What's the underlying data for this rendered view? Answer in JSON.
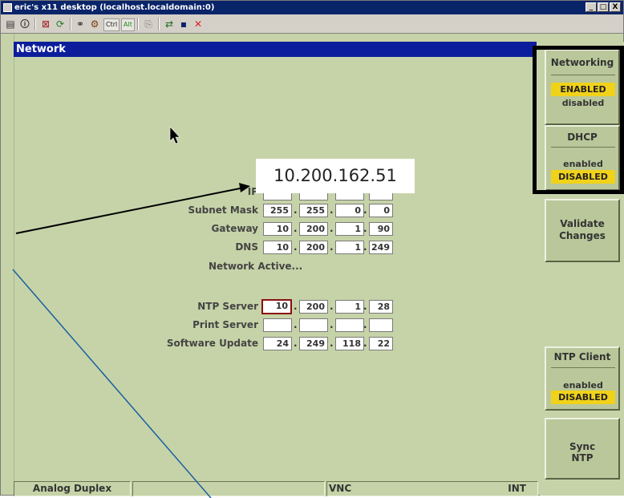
{
  "window": {
    "title": "eric's x11 desktop (localhost.localdomain:0)",
    "buttons": [
      "_",
      "□",
      "X"
    ]
  },
  "toolbar": {
    "icons": [
      "properties-icon",
      "info-icon",
      "fullscreen-icon",
      "refresh-icon",
      "pointer-icon",
      "keys-icon",
      "ctrl-key",
      "alt-key",
      "clipboard-icon",
      "transfer-icon",
      "save-icon",
      "disconnect-icon"
    ],
    "ctrl_label": "Ctrl",
    "alt_label": "Alt"
  },
  "header": {
    "title": "Network"
  },
  "callout": {
    "text": "10.200.162.51"
  },
  "form": {
    "ip_label_partial": "IP",
    "subnet": {
      "label": "Subnet Mask",
      "octets": [
        "255",
        "255",
        "0",
        "0"
      ]
    },
    "gateway": {
      "label": "Gateway",
      "octets": [
        "10",
        "200",
        "1",
        "90"
      ]
    },
    "dns": {
      "label": "DNS",
      "octets": [
        "10",
        "200",
        "1",
        "249"
      ]
    },
    "status": "Network Active...",
    "ntp": {
      "label": "NTP Server",
      "octets": [
        "10",
        "200",
        "1",
        "28"
      ]
    },
    "print": {
      "label": "Print Server",
      "octets": [
        "",
        "",
        "",
        ""
      ]
    },
    "update": {
      "label": "Software Update",
      "octets": [
        "24",
        "249",
        "118",
        "22"
      ]
    },
    "separator": "."
  },
  "right_panel": {
    "networking": {
      "title": "Networking",
      "opt1": "ENABLED",
      "opt2": "disabled",
      "selected": "ENABLED"
    },
    "dhcp": {
      "title": "DHCP",
      "opt1": "enabled",
      "opt2": "DISABLED",
      "selected": "DISABLED"
    },
    "validate": {
      "line1": "Validate",
      "line2": "Changes"
    },
    "ntp_client": {
      "title": "NTP Client",
      "opt1": "enabled",
      "opt2": "DISABLED",
      "selected": "DISABLED"
    },
    "sync": {
      "line1": "Sync",
      "line2": "NTP"
    }
  },
  "status_bar": {
    "cell1": "Analog Duplex",
    "cell2": "",
    "cell3": "VNC",
    "cell4": "INT"
  },
  "colors": {
    "background": "#c6d3a8",
    "header": "#0c1d9c",
    "selected_option": "#f1d21a",
    "highlight_border": "#8a1010",
    "callout_arrow": "#000000",
    "annotation_line": "#1a5fa0"
  }
}
